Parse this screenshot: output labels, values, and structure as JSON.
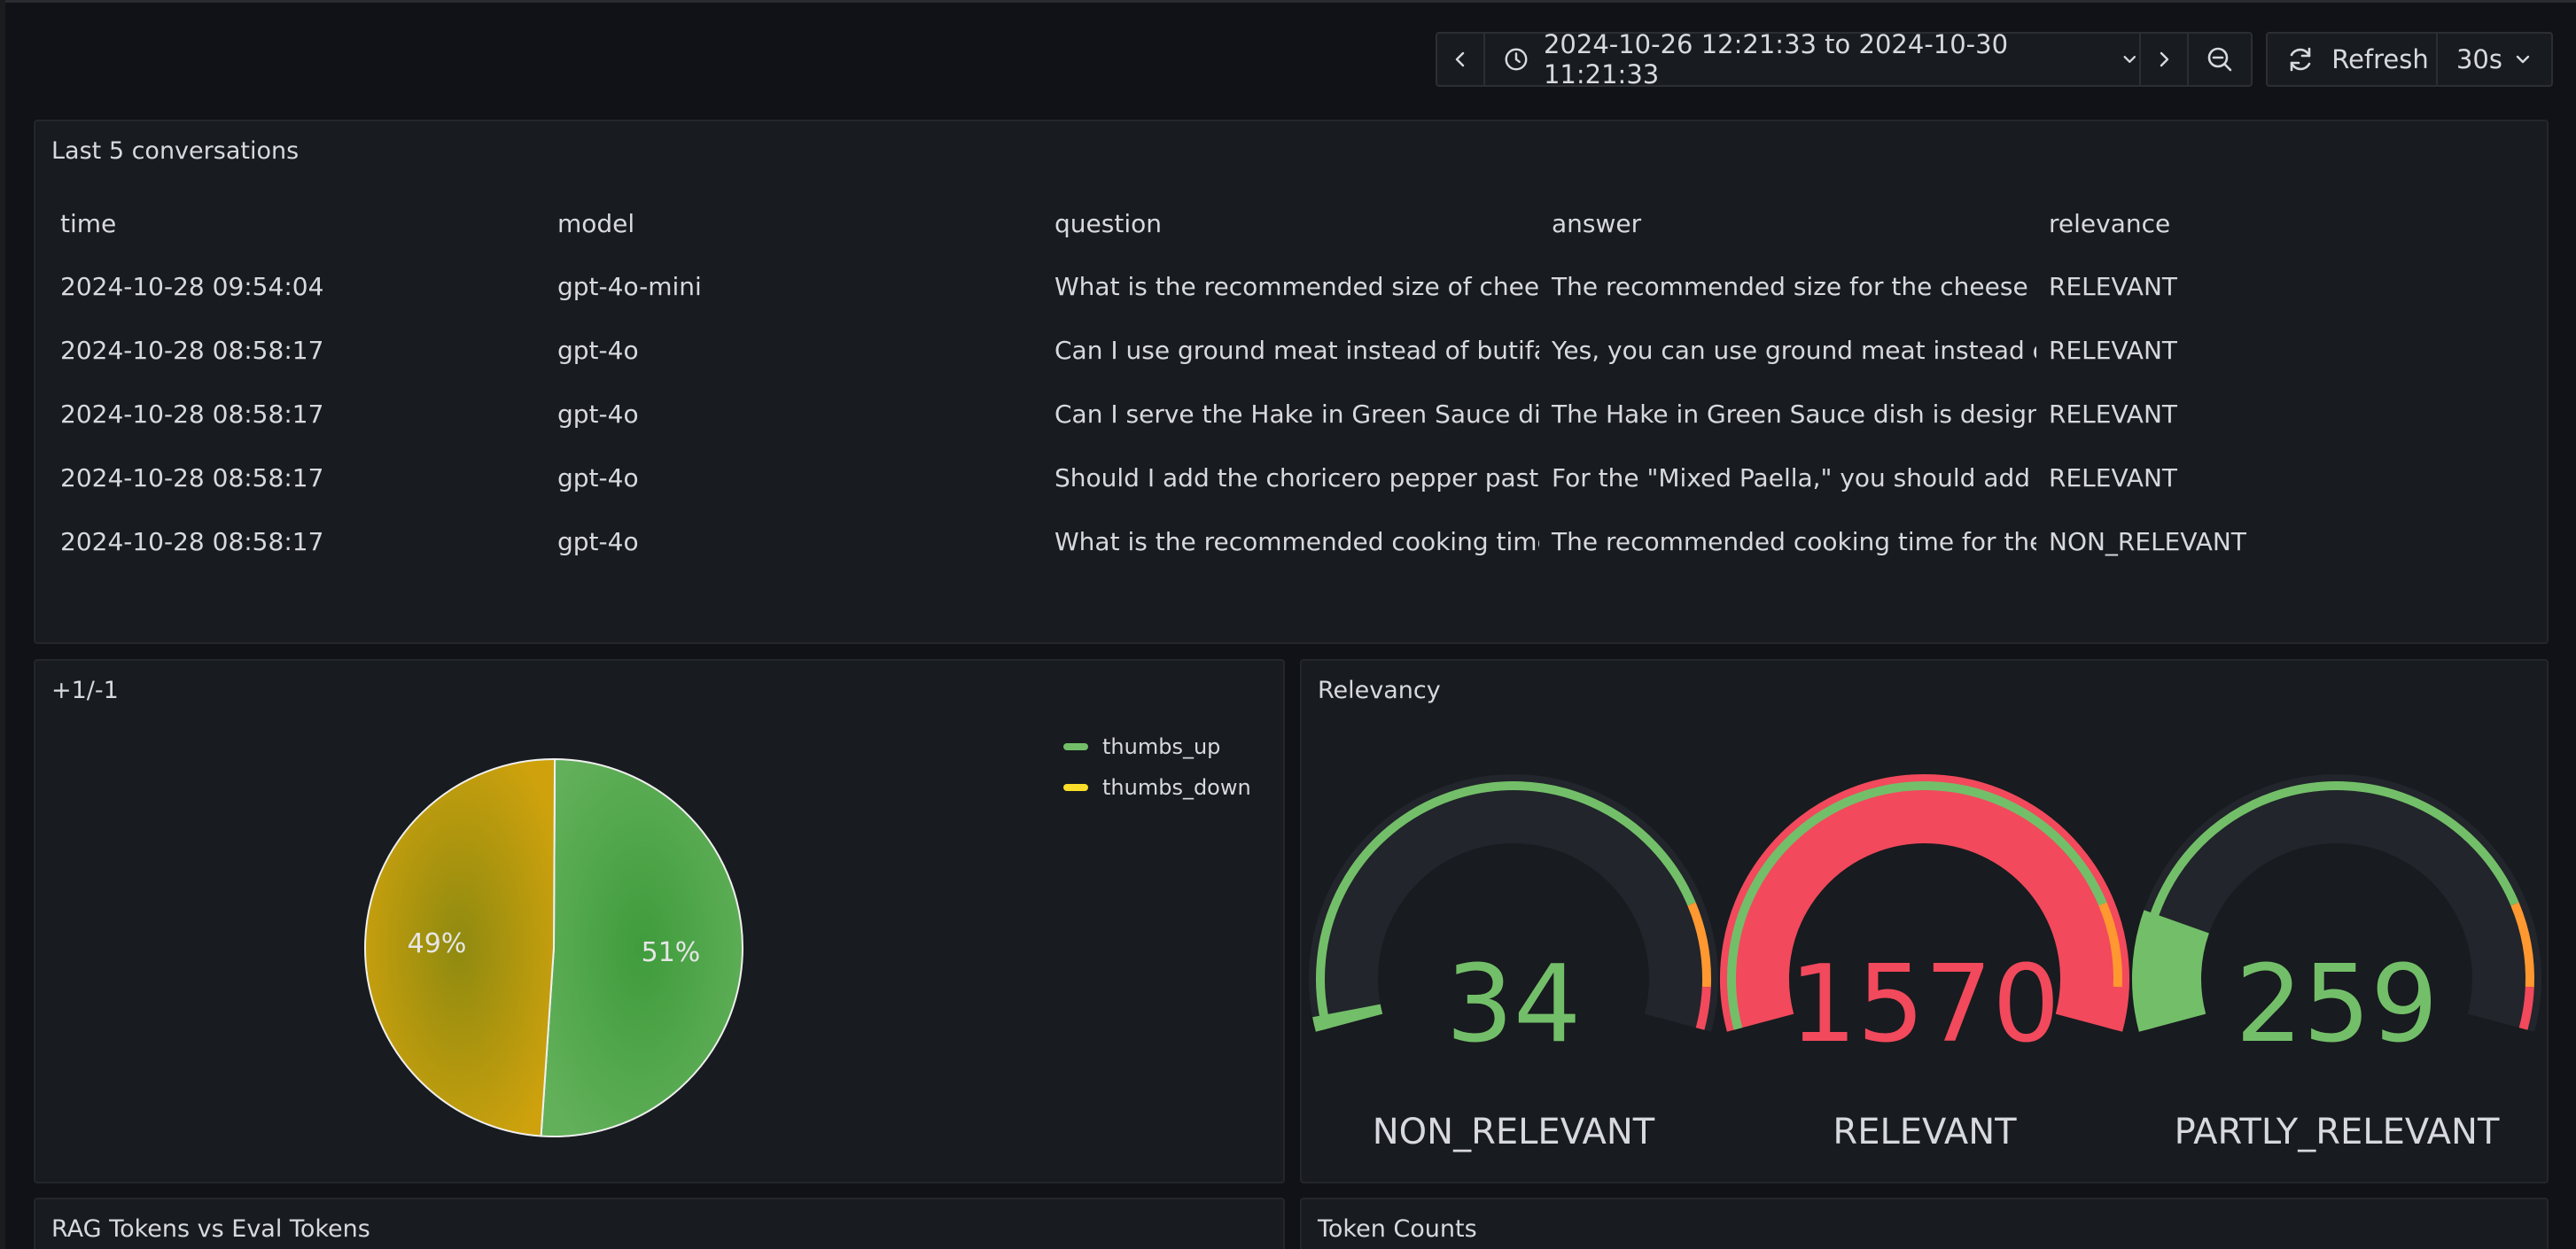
{
  "toolbar": {
    "time_range": "2024-10-26 12:21:33 to 2024-10-30 11:21:33",
    "refresh_label": "Refresh",
    "refresh_interval": "30s"
  },
  "conversations_panel": {
    "title": "Last 5 conversations",
    "columns": [
      "time",
      "model",
      "question",
      "answer",
      "relevance"
    ],
    "rows": [
      [
        "2024-10-28 09:54:04",
        "gpt-4o-mini",
        "What is the recommended size of cheese cubes",
        "The recommended size for the cheese cubes",
        "RELEVANT"
      ],
      [
        "2024-10-28 08:58:17",
        "gpt-4o",
        "Can I use ground meat instead of butifarra",
        "Yes, you can use ground meat instead of butifarra",
        "RELEVANT"
      ],
      [
        "2024-10-28 08:58:17",
        "gpt-4o",
        "Can I serve the Hake in Green Sauce dish",
        "The Hake in Green Sauce dish is designed",
        "RELEVANT"
      ],
      [
        "2024-10-28 08:58:17",
        "gpt-4o",
        "Should I add the choricero pepper paste",
        "For the \"Mixed Paella,\" you should add the",
        "RELEVANT"
      ],
      [
        "2024-10-28 08:58:17",
        "gpt-4o",
        "What is the recommended cooking time for",
        "The recommended cooking time for the Mixed",
        "NON_RELEVANT"
      ]
    ]
  },
  "feedback_panel": {
    "title": "+1/-1",
    "legend": [
      {
        "label": "thumbs_up",
        "color": "#73bf69"
      },
      {
        "label": "thumbs_down",
        "color": "#fade2a"
      }
    ],
    "chart_data": {
      "type": "pie",
      "categories": [
        "thumbs_up",
        "thumbs_down"
      ],
      "values": [
        51,
        49
      ],
      "labels": [
        "51%",
        "49%"
      ],
      "colors": [
        "#56a64b",
        "#c8a00f"
      ]
    }
  },
  "relevancy_panel": {
    "title": "Relevancy",
    "gauges": [
      {
        "label": "NON_RELEVANT",
        "value": "34",
        "value_color": "#73bf69",
        "fill_color": "#73bf69",
        "fill_fraction": 0.02
      },
      {
        "label": "RELEVANT",
        "value": "1570",
        "value_color": "#f2495c",
        "fill_color": "#f2495c",
        "fill_fraction": 1.0
      },
      {
        "label": "PARTLY_RELEVANT",
        "value": "259",
        "value_color": "#73bf69",
        "fill_color": "#73bf69",
        "fill_fraction": 0.165
      }
    ]
  },
  "tokens_panel": {
    "title": "RAG Tokens vs Eval Tokens"
  },
  "token_counts_panel": {
    "title": "Token Counts"
  }
}
